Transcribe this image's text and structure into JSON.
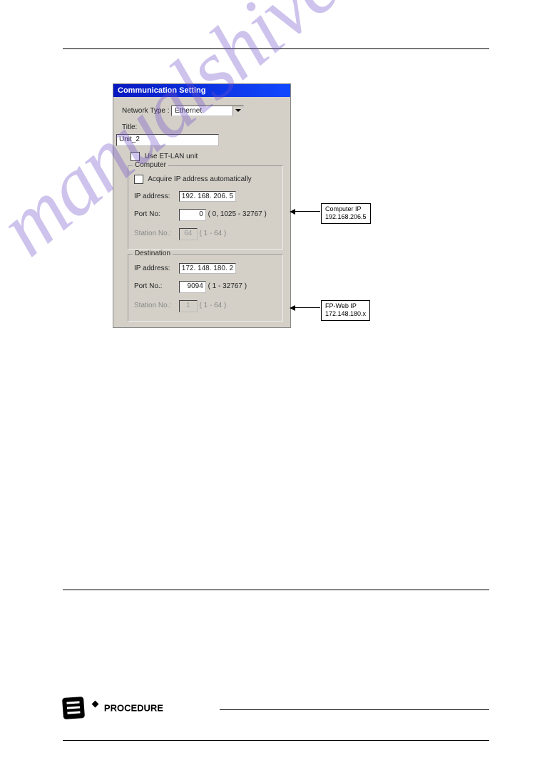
{
  "header": {
    "right": ""
  },
  "watermark": "manualshive.com",
  "dialog": {
    "title": "Communication Setting",
    "networkType": {
      "label": "Network Type : ",
      "value": "Ethernet"
    },
    "titleField": {
      "label": "Title:",
      "value": "Unit_2"
    },
    "etlan": "Use ET-LAN unit",
    "computer": {
      "group": "Computer",
      "auto": "Acquire IP address automatically",
      "ipLabel": "IP address:",
      "ip": [
        "192",
        "168",
        "206",
        "5"
      ],
      "portLabel": "Port No:",
      "port": "0",
      "portRange": " ( 0, 1025 - 32767 )",
      "stationLabel": "Station No.:",
      "station": "64",
      "stationRange": "  ( 1 - 64 )"
    },
    "dest": {
      "group": "Destination",
      "ipLabel": "IP address:",
      "ip": [
        "172",
        "148",
        "180",
        "2"
      ],
      "portLabel": "Port No.:",
      "port": "9094",
      "portRange": " ( 1 - 32767 )",
      "stationLabel": "Station No.:",
      "station": "1",
      "stationRange": "  ( 1 - 64 )"
    }
  },
  "callouts": {
    "comp": {
      "line1": "Computer IP",
      "line2": "192.168.206.5"
    },
    "dest": {
      "line1": "FP-Web IP",
      "line2": "172.148.180.x"
    }
  },
  "notes": {
    "heading": "",
    "items": [
      "",
      "",
      "",
      "",
      "",
      ""
    ]
  },
  "closing": "",
  "section": {
    "num": "",
    "title": "",
    "desc": ""
  },
  "procedure": "PROCEDURE",
  "pageNum": ""
}
